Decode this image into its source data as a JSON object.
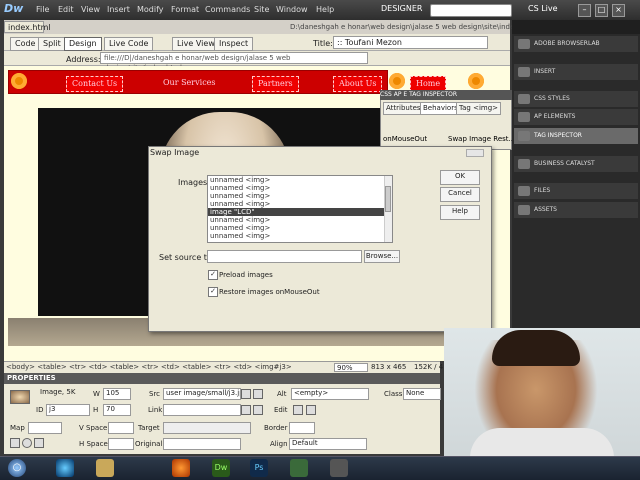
{
  "app": {
    "logo": "Dw",
    "menus": [
      "File",
      "Edit",
      "View",
      "Insert",
      "Modify",
      "Format",
      "Commands",
      "Site",
      "Window",
      "Help"
    ],
    "workspace": "DESIGNER",
    "cslive": "CS Live"
  },
  "document": {
    "tab": "index.html",
    "path": "D:\\daneshgah e honar\\web design\\jalase 5 web design\\site\\index.html",
    "views": [
      "Code",
      "Split",
      "Design",
      "Live Code",
      "Live View",
      "Inspect"
    ],
    "title_label": "Title:",
    "title_value": ":: Toufani Mezon",
    "address_label": "Address:",
    "address_value": "file:///D|/daneshgah e honar/web design/jalase 5 web design/site/index.html"
  },
  "site_nav": [
    "Contact Us",
    "Our Services",
    "Partners",
    "About Us",
    "Home"
  ],
  "tag_inspector": {
    "tabs_top": [
      "CSS",
      "AP E",
      "TAG INSPECTOR"
    ],
    "tabs": [
      "Attributes",
      "Behaviors",
      "Tag <img>"
    ],
    "event": "onMouseOut",
    "action": "Swap Image Rest..."
  },
  "dialog": {
    "title": "Swap Image",
    "images_label": "Images:",
    "images": [
      "unnamed <img>",
      "unnamed <img>",
      "unnamed <img>",
      "unnamed <img>",
      "image \"LCD\"",
      "unnamed <img>",
      "unnamed <img>",
      "unnamed <img>"
    ],
    "selected_index": 4,
    "source_label": "Set source to:",
    "source_value": "",
    "browse": "Browse...",
    "preload": "Preload images",
    "restore": "Restore images onMouseOut",
    "ok": "OK",
    "cancel": "Cancel",
    "help": "Help"
  },
  "statusbar": {
    "tagpath": "<body> <table> <tr> <td> <table> <tr> <td> <table> <tr> <td> <img#j3>",
    "zoom": "90%",
    "dimensions": "813 x 465",
    "filesize": "152K / 4"
  },
  "properties": {
    "header": "PROPERTIES",
    "kind": "Image, 5K",
    "id_label": "ID",
    "id": "j3",
    "w_label": "W",
    "w": "105",
    "h_label": "H",
    "h": "70",
    "src_label": "Src",
    "src": "user image/small/j3.jpg",
    "link_label": "Link",
    "link": "",
    "alt_label": "Alt",
    "alt": "<empty>",
    "edit_label": "Edit",
    "class_label": "Class",
    "class": "None",
    "map_label": "Map",
    "vspace_label": "V Space",
    "hspace_label": "H Space",
    "target_label": "Target",
    "original_label": "Original",
    "border_label": "Border",
    "align_label": "Align",
    "align": "Default"
  },
  "panels": [
    "ADOBE BROWSERLAB",
    "INSERT",
    "CSS STYLES",
    "AP ELEMENTS",
    "TAG INSPECTOR",
    "BUSINESS CATALYST",
    "FILES",
    "ASSETS"
  ],
  "highlighted_panel": "TAG INSPECTOR",
  "taskbar": [
    "start",
    "ie",
    "explorer",
    "firefox",
    "dreamweaver",
    "photoshop",
    "windows",
    "misc"
  ]
}
